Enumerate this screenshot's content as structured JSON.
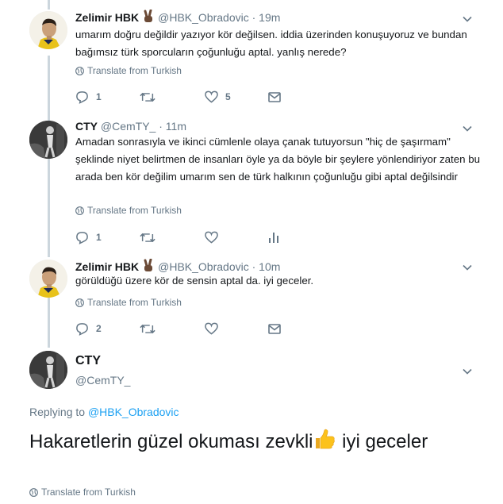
{
  "tweets": [
    {
      "name": "Zelimir HBK",
      "handle": "@HBK_Obradovic",
      "time": "19m",
      "text": "umarım doğru değildir yazıyor kör değilsen. iddia üzerinden konuşuyoruz ve bundan bağımsız türk sporcuların çoğunluğu aptal. yanlış nerede?",
      "translate": "Translate from Turkish",
      "reply_count": "1",
      "like_count": "5"
    },
    {
      "name": "CTY",
      "handle": "@CemTY_",
      "time": "11m",
      "text": "Amadan sonrasıyla ve ikinci cümlenle olaya çanak tutuyorsun \"hiç de şaşırmam\" şeklinde niyet belirtmen de insanları öyle ya da böyle bir şeylere yönlendiriyor zaten bu arada ben kör değilim umarım sen de türk halkının çoğunluğu gibi aptal değilsindir",
      "translate": "Translate from Turkish",
      "reply_count": "1"
    },
    {
      "name": "Zelimir HBK",
      "handle": "@HBK_Obradovic",
      "time": "10m",
      "text": "görüldüğü üzere kör de sensin aptal da. iyi geceler.",
      "translate": "Translate from Turkish",
      "reply_count": "2"
    }
  ],
  "main_tweet": {
    "name": "CTY",
    "handle": "@CemTY_",
    "replying_prefix": "Replying to",
    "replying_to": "@HBK_Obradovic",
    "text_before": "Hakaretlerin güzel okuması zevkli",
    "text_after": " iyi geceler",
    "translate": "Translate from Turkish"
  },
  "colors": {
    "text": "#14171a",
    "secondary": "#657786",
    "link": "#1da1f2",
    "thread_line": "#ccd6dd"
  },
  "icons": [
    "reply-icon",
    "retweet-icon",
    "like-icon",
    "message-icon",
    "analytics-icon",
    "globe-icon",
    "chevron-down-icon",
    "victory-hand-emoji",
    "thumbs-up-emoji"
  ]
}
